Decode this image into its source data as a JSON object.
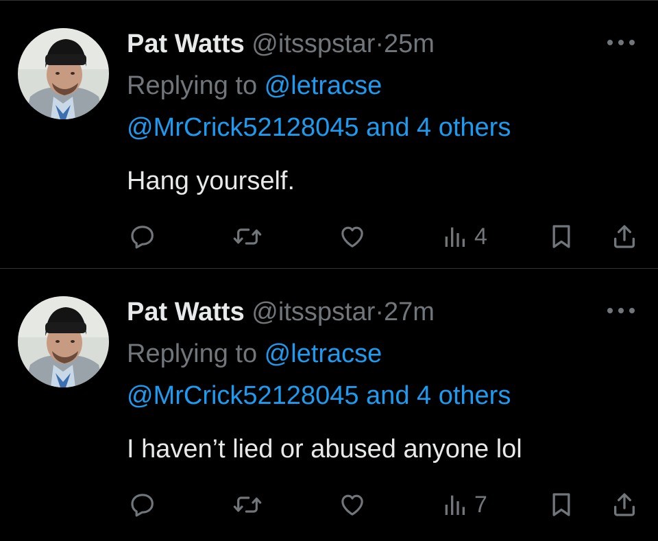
{
  "tweets": [
    {
      "author_name": "Pat Watts",
      "author_handle": "@itsspstar",
      "separator": "·",
      "time": "25m",
      "replying_prefix": "Replying to ",
      "replying_mention": "@letracse",
      "replying_line2": "@MrCrick52128045 and 4 others",
      "text": "Hang yourself.",
      "views": "4"
    },
    {
      "author_name": "Pat Watts",
      "author_handle": "@itsspstar",
      "separator": "·",
      "time": "27m",
      "replying_prefix": "Replying to ",
      "replying_mention": "@letracse",
      "replying_line2": "@MrCrick52128045 and 4 others",
      "text": "I haven’t lied or abused anyone lol",
      "views": "7"
    }
  ],
  "icons": {
    "reply": "reply-icon",
    "retweet": "retweet-icon",
    "like": "like-icon",
    "views": "views-icon",
    "bookmark": "bookmark-icon",
    "share": "share-icon",
    "more": "more-icon"
  },
  "colors": {
    "background": "#000000",
    "text_primary": "#e7e9ea",
    "text_secondary": "#71767b",
    "accent": "#1d9bf0",
    "divider": "#2f3336"
  }
}
